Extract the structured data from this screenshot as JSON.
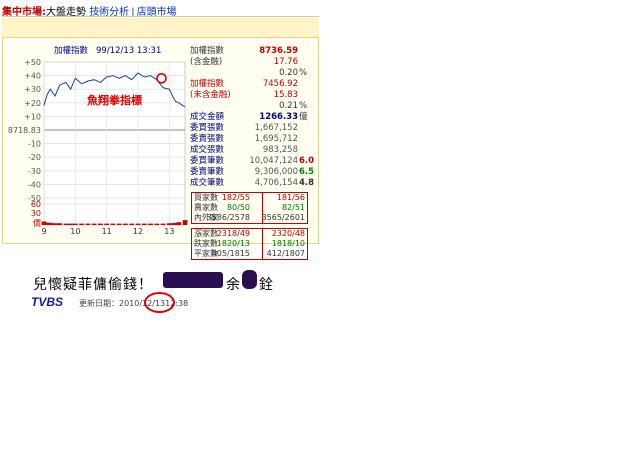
{
  "nav": {
    "label": "集中市場:",
    "item1": "大盤走勢",
    "item2": "技術分析",
    "sep": "|",
    "item3": "店頭市場"
  },
  "chart": {
    "title": "加權指數",
    "datetime": "99/12/13 13:31",
    "annotation": "魚翔拳指標",
    "ref_value": "8718.83",
    "y_ticks": [
      "+50",
      "+40",
      "+30",
      "+20",
      "+10",
      "-10",
      "-20",
      "-30",
      "-40",
      "-50",
      "60",
      "30",
      "價"
    ],
    "x_ticks": [
      "9",
      "10",
      "11",
      "12",
      "13"
    ]
  },
  "chart_data": {
    "type": "line",
    "x_ticks": [
      "9",
      "10",
      "11",
      "12",
      "13"
    ],
    "y_ticks": [
      "+50",
      "+40",
      "+30",
      "+20",
      "+10",
      "8718.83",
      "-10",
      "-20",
      "-30",
      "-40",
      "-50"
    ],
    "ylim": [
      -50,
      50
    ],
    "series": [
      {
        "x": [
          9.0,
          9.1,
          9.2,
          9.35,
          9.5,
          9.7,
          9.85,
          10.0,
          10.2,
          10.4,
          10.6,
          10.8,
          11.0,
          11.2,
          11.4,
          11.6,
          11.8,
          12.0,
          12.2,
          12.4,
          12.6,
          12.8,
          13.0,
          13.1,
          13.2,
          13.3,
          13.5
        ],
        "y": [
          18,
          26,
          30,
          25,
          33,
          35,
          30,
          38,
          34,
          36,
          37,
          35,
          39,
          40,
          38,
          40,
          37,
          42,
          39,
          40,
          37,
          31,
          30,
          25,
          21,
          20,
          17
        ]
      }
    ],
    "volume_ylim": [
      0,
      60
    ],
    "volume": [
      10,
      7,
      6,
      5,
      5,
      4,
      4,
      4,
      4,
      4,
      4,
      4,
      4,
      4,
      4,
      4,
      4,
      4,
      4,
      4,
      4,
      4,
      5,
      5,
      6,
      8,
      14
    ]
  },
  "table": {
    "rows": [
      {
        "k": "加權指數",
        "v": "8736.59",
        "u": "",
        "kc": "dk",
        "vc": "red bold"
      },
      {
        "k": "(含金融)",
        "v": "17.76",
        "u": "",
        "kc": "dk",
        "vc": "red"
      },
      {
        "k": "",
        "v": "0.20",
        "u": "%",
        "kc": "dk",
        "vc": "dk"
      },
      {
        "k": "加權指數",
        "v": "7456.92",
        "u": "",
        "kc": "red",
        "vc": "red"
      },
      {
        "k": "(未含金融)",
        "v": "15.83",
        "u": "",
        "kc": "red",
        "vc": "red"
      },
      {
        "k": "",
        "v": "0.21",
        "u": "%",
        "kc": "dk",
        "vc": "dk"
      },
      {
        "k": "成交金額",
        "v": "1266.33",
        "u": "億",
        "kc": "navy",
        "vc": "navy bold"
      },
      {
        "k": "委買張數",
        "v": "1,667,152",
        "u": "",
        "kc": "navy",
        "vc": "gray"
      },
      {
        "k": "委賣張數",
        "v": "1,695,712",
        "u": "",
        "kc": "navy",
        "vc": "gray"
      },
      {
        "k": "成交張數",
        "v": "983,258",
        "u": "",
        "kc": "navy",
        "vc": "gray"
      },
      {
        "k": "委買筆數",
        "v": "10,047,124",
        "u": "6.0",
        "kc": "navy",
        "vc": "gray",
        "uc": "red bold"
      },
      {
        "k": "委賣筆數",
        "v": "9,306,000",
        "u": "6.5",
        "kc": "navy",
        "vc": "gray",
        "uc": "green bold"
      },
      {
        "k": "成交筆數",
        "v": "4,706,154",
        "u": "4.8",
        "kc": "navy",
        "vc": "gray",
        "uc": "dk bold"
      }
    ],
    "box1": [
      {
        "a": "買家數",
        "b": "182/55",
        "c": "181/56",
        "bc": "red",
        "cc": "red"
      },
      {
        "a": "賣家數",
        "b": "80/50",
        "c": "82/51",
        "bc": "green",
        "cc": "green"
      },
      {
        "a": "內外家",
        "b": "3586/2578",
        "c": "3565/2601",
        "bc": "dk",
        "cc": "dk"
      }
    ],
    "box2": [
      {
        "a": "漲家數",
        "b": "2318/49",
        "c": "2320/48",
        "bc": "red",
        "cc": "red"
      },
      {
        "a": "跌家數",
        "b": "1820/13",
        "c": "1818/10",
        "bc": "green",
        "cc": "green"
      },
      {
        "a": "平家數",
        "b": "405/1815",
        "c": "412/1807",
        "bc": "dk",
        "cc": "dk"
      }
    ]
  },
  "headline": {
    "text": "兒懷疑菲傭偷錢！",
    "tail1": "余",
    "tail2": "銓"
  },
  "source": {
    "logo": "TVBS",
    "update_label": "更新日期：2010/12/13",
    "update_time": "12:38"
  }
}
